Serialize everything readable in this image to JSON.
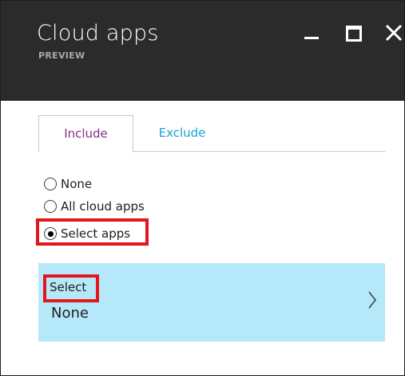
{
  "blade": {
    "title": "Cloud apps",
    "subtitle": "PREVIEW"
  },
  "window_controls": {
    "minimize_icon": "minimize-icon",
    "maximize_icon": "maximize-icon",
    "close_icon": "close-icon"
  },
  "tabs": [
    {
      "label": "Include",
      "selected": true
    },
    {
      "label": "Exclude",
      "selected": false
    }
  ],
  "options": [
    {
      "label": "None",
      "checked": false
    },
    {
      "label": "All cloud apps",
      "checked": false
    },
    {
      "label": "Select apps",
      "checked": true
    }
  ],
  "select_panel": {
    "label": "Select",
    "value": "None",
    "chevron_icon": "chevron-right-icon"
  },
  "colors": {
    "header_bg": "#2b2b2b",
    "tab_include": "#8a2f8a",
    "tab_exclude": "#1aa3d1",
    "panel_bg": "#b5e8f8",
    "highlight": "#e3161e"
  }
}
